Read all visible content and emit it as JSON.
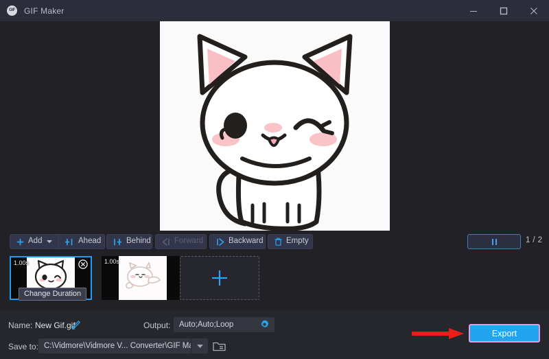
{
  "window": {
    "title": "GIF Maker",
    "logo_text": "GIF",
    "minimize_icon": "minimize-icon",
    "maximize_icon": "maximize-icon",
    "close_icon": "close-icon"
  },
  "preview": {
    "alt": "white kawaii cat winking illustration"
  },
  "toolbar": {
    "buttons": [
      {
        "label": "Add",
        "icon": "plus-icon",
        "has_caret": true,
        "disabled": false
      },
      {
        "label": "Ahead",
        "icon": "insert-ahead-icon",
        "has_caret": false,
        "disabled": false
      },
      {
        "label": "Behind",
        "icon": "insert-behind-icon",
        "has_caret": false,
        "disabled": false
      },
      {
        "label": "Forward",
        "icon": "move-forward-icon",
        "has_caret": false,
        "disabled": true
      },
      {
        "label": "Backward",
        "icon": "move-backward-icon",
        "has_caret": false,
        "disabled": false
      },
      {
        "label": "Empty",
        "icon": "trash-icon",
        "has_caret": false,
        "disabled": false
      }
    ],
    "play_icon": "pause-icon",
    "counter": "1 / 2"
  },
  "strip": {
    "frames": [
      {
        "duration": "1.00s",
        "selected": true,
        "remove_icon": "remove-circle-icon",
        "art": "cat-sitting"
      },
      {
        "duration": "1.00s",
        "selected": false,
        "remove_icon": "remove-circle-icon",
        "art": "cat-lying"
      }
    ],
    "tooltip": "Change Duration",
    "add_slot_icon": "plus-icon"
  },
  "bottom": {
    "name_label": "Name:",
    "name_value": "New Gif.gif",
    "edit_icon": "pencil-icon",
    "output_label": "Output:",
    "output_value": "Auto;Auto;Loop",
    "settings_icon": "gear-icon",
    "save_to_label": "Save to:",
    "save_to_value": "C:\\Vidmore\\Vidmore V... Converter\\GIF Maker",
    "dropdown_icon": "chevron-down-icon",
    "folder_icon": "folder-icon",
    "export_label": "Export"
  },
  "annotation": {
    "arrow_icon": "red-arrow-icon",
    "arrow_color": "#ee1b1b",
    "highlight_color": "#e79ce0"
  },
  "colors": {
    "accent": "#22a5f0",
    "window_bg": "#222226",
    "titlebar_bg": "#2b2d3a",
    "panel_bg": "#26272d",
    "button_bg": "#33364a"
  }
}
